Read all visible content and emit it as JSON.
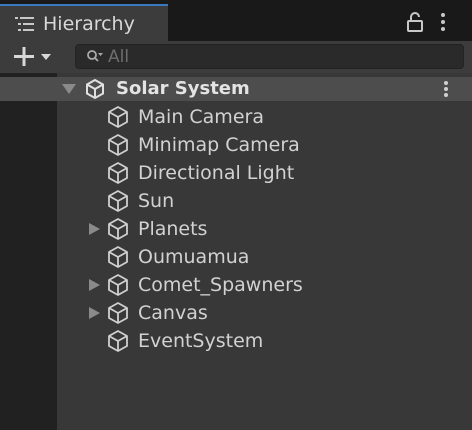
{
  "tab": {
    "title": "Hierarchy",
    "icon": "list-icon",
    "lock_icon": "lock-icon",
    "menu_icon": "kebab-icon"
  },
  "toolbar": {
    "add_icon": "plus-dropdown-icon",
    "search_placeholder": "All",
    "search_icon": "search-filter-icon",
    "search_value": ""
  },
  "scene": {
    "name": "Solar System",
    "icon": "unity-logo-icon",
    "expanded": true,
    "menu_icon": "kebab-icon"
  },
  "items": [
    {
      "label": "Main Camera",
      "has_children": false,
      "icon": "gameobject-cube-icon"
    },
    {
      "label": "Minimap Camera",
      "has_children": false,
      "icon": "gameobject-cube-icon"
    },
    {
      "label": "Directional Light",
      "has_children": false,
      "icon": "gameobject-cube-icon"
    },
    {
      "label": "Sun",
      "has_children": false,
      "icon": "gameobject-cube-icon"
    },
    {
      "label": "Planets",
      "has_children": true,
      "icon": "gameobject-cube-icon"
    },
    {
      "label": "Oumuamua",
      "has_children": false,
      "icon": "gameobject-cube-icon"
    },
    {
      "label": "Comet_Spawners",
      "has_children": true,
      "icon": "gameobject-cube-icon"
    },
    {
      "label": "Canvas",
      "has_children": true,
      "icon": "gameobject-cube-icon"
    },
    {
      "label": "EventSystem",
      "has_children": false,
      "icon": "gameobject-cube-icon"
    }
  ],
  "colors": {
    "accent": "#3a79bb",
    "panel": "#383838",
    "scene_row": "#4d4d4d",
    "text": "#d2d2d2"
  }
}
